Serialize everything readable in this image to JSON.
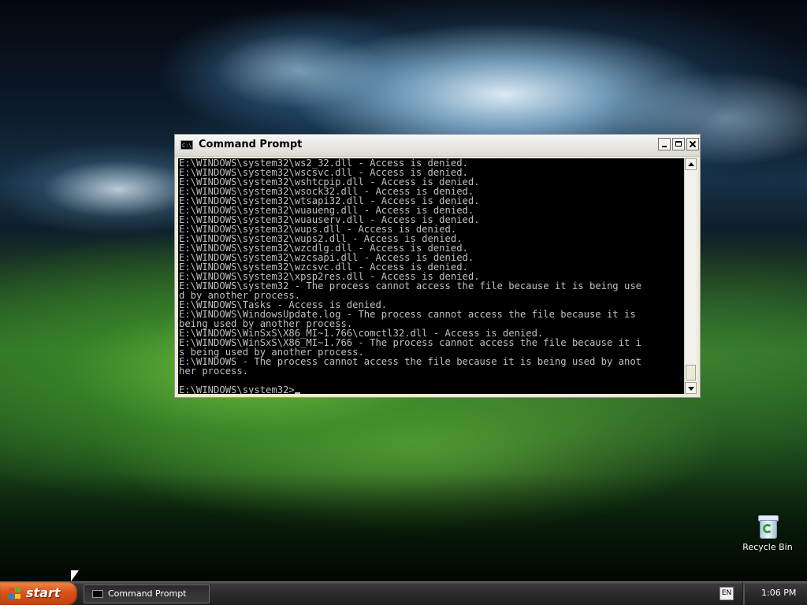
{
  "desktop": {
    "icons": [
      {
        "label": "Recycle Bin",
        "icon": "recycle-bin-icon"
      }
    ]
  },
  "window": {
    "title": "Command Prompt",
    "icon": "cmd-icon",
    "icon_text": "C:\\",
    "controls": {
      "minimize": "minimize",
      "maximize": "maximize",
      "close": "close"
    }
  },
  "console": {
    "lines": [
      "E:\\WINDOWS\\system32\\ws2_32.dll - Access is denied.",
      "E:\\WINDOWS\\system32\\wscsvc.dll - Access is denied.",
      "E:\\WINDOWS\\system32\\wshtcpip.dll - Access is denied.",
      "E:\\WINDOWS\\system32\\wsock32.dll - Access is denied.",
      "E:\\WINDOWS\\system32\\wtsapi32.dll - Access is denied.",
      "E:\\WINDOWS\\system32\\wuaueng.dll - Access is denied.",
      "E:\\WINDOWS\\system32\\wuauserv.dll - Access is denied.",
      "E:\\WINDOWS\\system32\\wups.dll - Access is denied.",
      "E:\\WINDOWS\\system32\\wups2.dll - Access is denied.",
      "E:\\WINDOWS\\system32\\wzcdlg.dll - Access is denied.",
      "E:\\WINDOWS\\system32\\wzcsapi.dll - Access is denied.",
      "E:\\WINDOWS\\system32\\wzcsvc.dll - Access is denied.",
      "E:\\WINDOWS\\system32\\xpsp2res.dll - Access is denied.",
      "E:\\WINDOWS\\system32 - The process cannot access the file because it is being use",
      "d by another process.",
      "E:\\WINDOWS\\Tasks - Access is denied.",
      "E:\\WINDOWS\\WindowsUpdate.log - The process cannot access the file because it is",
      "being used by another process.",
      "E:\\WINDOWS\\WinSxS\\X86_MI~1.766\\comctl32.dll - Access is denied.",
      "E:\\WINDOWS\\WinSxS\\X86_MI~1.766 - The process cannot access the file because it i",
      "s being used by another process.",
      "E:\\WINDOWS - The process cannot access the file because it is being used by anot",
      "her process.",
      "",
      "E:\\WINDOWS\\system32>"
    ],
    "text_color": "#c0c0c0",
    "background_color": "#000000"
  },
  "taskbar": {
    "start_label": "start",
    "tasks": [
      {
        "label": "Command Prompt",
        "icon": "cmd-icon"
      }
    ],
    "tray": {
      "language": "EN",
      "clock": "1:06 PM"
    }
  },
  "colors": {
    "start_button": "#d9521a",
    "taskbar": "#2b2b2b",
    "window_frame": "#ece9d8"
  }
}
